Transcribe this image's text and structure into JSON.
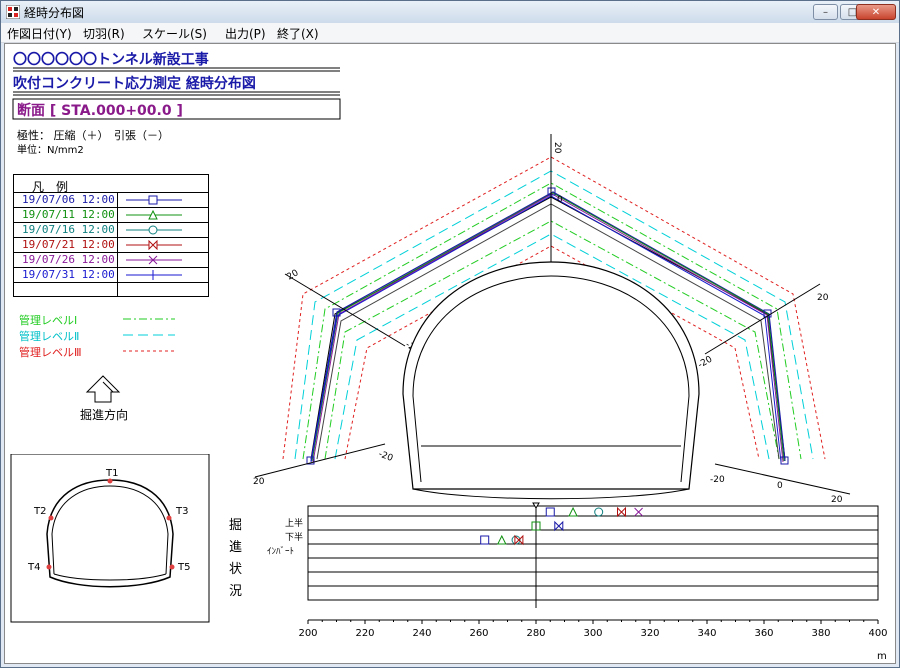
{
  "window": {
    "title": "経時分布図",
    "min": "–",
    "max": "□",
    "close": "✕"
  },
  "menu": [
    "作図日付(Y)",
    "切羽(R)",
    "スケール(S)",
    "出力(P)",
    "終了(X)"
  ],
  "header": {
    "project": "〇〇〇〇〇〇トンネル新設工事",
    "measurement": "吹付コンクリート応力測定 経時分布図",
    "section": "断面 [ STA.000+00.0 ]",
    "polarity": "極性： 圧縮（＋）　引張（－）",
    "unit": "単位：N/mm2"
  },
  "legend": {
    "heading": "凡　例",
    "entries": [
      {
        "date": "19/07/06 12:00",
        "color": "#1a1aa8",
        "marker": "square"
      },
      {
        "date": "19/07/11 12:00",
        "color": "#109010",
        "marker": "triangle"
      },
      {
        "date": "19/07/16 12:00",
        "color": "#108080",
        "marker": "circle"
      },
      {
        "date": "19/07/21 12:00",
        "color": "#b01010",
        "marker": "bowtie"
      },
      {
        "date": "19/07/26 12:00",
        "color": "#8a1a9a",
        "marker": "x"
      },
      {
        "date": "19/07/31 12:00",
        "color": "#1a1ad0",
        "marker": "plus"
      }
    ]
  },
  "levels": [
    {
      "label": "管理レベルⅠ",
      "color": "#22cc22",
      "dash": "8,3,2,3"
    },
    {
      "label": "管理レベルⅡ",
      "color": "#00d0d8",
      "dash": "10,5"
    },
    {
      "label": "管理レベルⅢ",
      "color": "#e02020",
      "dash": "3,3"
    }
  ],
  "direction_label": "掘進方向",
  "key_plan": {
    "points": [
      "T1",
      "T2",
      "T3",
      "T4",
      "T5"
    ]
  },
  "distribution": {
    "ticks": {
      "ring": "20",
      "ring_neg": "-20",
      "zero": "0"
    }
  },
  "progress": {
    "side_label": [
      "掘",
      "進",
      "状",
      "況"
    ],
    "rows": [
      "上半",
      "下半",
      "ｲﾝﾊﾞｰﾄ"
    ],
    "x_ticks": [
      "200",
      "220",
      "240",
      "260",
      "280",
      "300",
      "320",
      "340",
      "360",
      "380",
      "400"
    ],
    "x_unit": "m",
    "current_position": 280,
    "marks": {
      "upper": [
        285,
        293,
        302,
        310,
        316
      ],
      "lower": [
        280,
        288
      ],
      "invert": [
        262,
        268,
        273,
        274
      ]
    }
  }
}
